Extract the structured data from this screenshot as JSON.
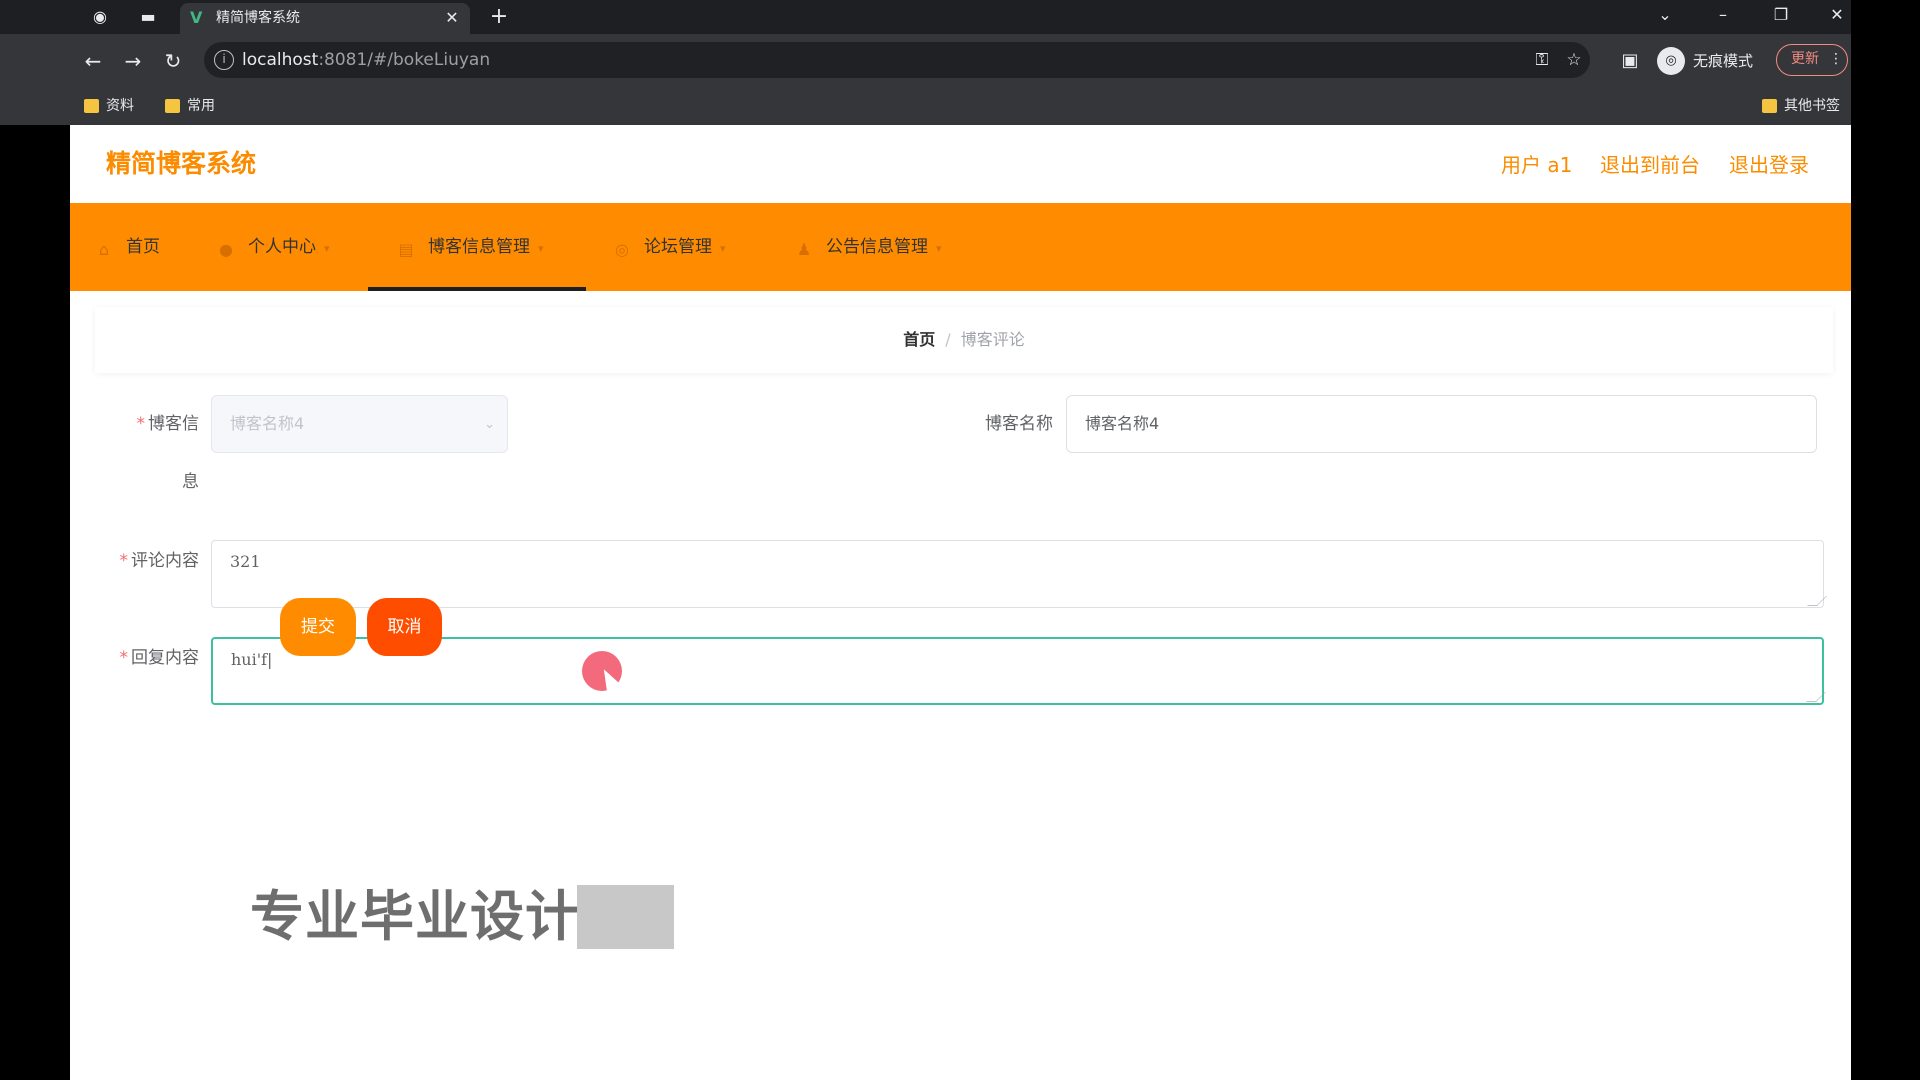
{
  "browser": {
    "tab_title": "精简博客系统",
    "url_host": "localhost",
    "url_rest": ":8081/#/bokeLiuyan",
    "incognito_label": "无痕模式",
    "update_label": "更新",
    "bookmarks": [
      {
        "label": "资料"
      },
      {
        "label": "常用"
      }
    ],
    "other_bookmarks": "其他书签"
  },
  "header": {
    "title": "精简博客系统",
    "user": "用户 a1",
    "to_front": "退出到前台",
    "logout": "退出登录"
  },
  "menu": {
    "items": [
      {
        "label": "首页",
        "icon": "home-icon"
      },
      {
        "label": "个人中心",
        "icon": "user-icon"
      },
      {
        "label": "博客信息管理",
        "icon": "doc-icon",
        "active": true
      },
      {
        "label": "论坛管理",
        "icon": "forum-icon"
      },
      {
        "label": "公告信息管理",
        "icon": "notice-icon"
      }
    ]
  },
  "breadcrumb": {
    "home": "首页",
    "separator": "/",
    "current": "博客评论"
  },
  "form": {
    "blog_info_label_1": "博客信",
    "blog_info_label_2": "息",
    "blog_info_value": "博客名称4",
    "blog_name_label": "博客名称",
    "blog_name_value": "博客名称4",
    "comment_label": "评论内容",
    "comment_value": "321",
    "reply_label": "回复内容",
    "reply_value": "hui'f|",
    "submit": "提交",
    "cancel": "取消"
  },
  "watermark": {
    "text": "专业毕业设计"
  },
  "colors": {
    "accent": "#ff8c00",
    "cancel": "#ff4d00",
    "focus": "#3cc0a0"
  }
}
